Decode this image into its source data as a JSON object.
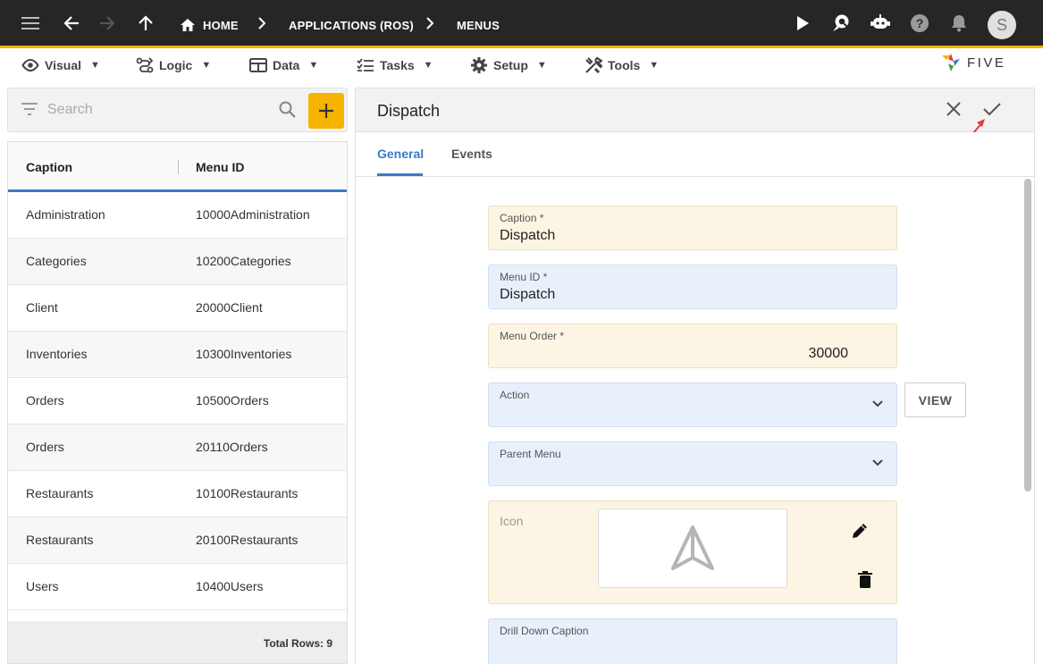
{
  "topbar": {
    "breadcrumbs": [
      "HOME",
      "APPLICATIONS (ROS)",
      "MENUS"
    ],
    "avatar_initial": "S"
  },
  "menubar": {
    "items": [
      {
        "label": "Visual",
        "icon": "eye-icon"
      },
      {
        "label": "Logic",
        "icon": "logic-icon"
      },
      {
        "label": "Data",
        "icon": "table-icon"
      },
      {
        "label": "Tasks",
        "icon": "tasks-icon"
      },
      {
        "label": "Setup",
        "icon": "gear-icon"
      },
      {
        "label": "Tools",
        "icon": "tools-icon"
      }
    ],
    "arrow": "▼",
    "logo_text": "FIVE"
  },
  "list": {
    "search_placeholder": "Search",
    "columns": [
      "Caption",
      "Menu ID"
    ],
    "rows": [
      [
        "Administration",
        "10000Administration"
      ],
      [
        "Categories",
        "10200Categories"
      ],
      [
        "Client",
        "20000Client"
      ],
      [
        "Inventories",
        "10300Inventories"
      ],
      [
        "Orders",
        "10500Orders"
      ],
      [
        "Orders",
        "20110Orders"
      ],
      [
        "Restaurants",
        "10100Restaurants"
      ],
      [
        "Restaurants",
        "20100Restaurants"
      ],
      [
        "Users",
        "10400Users"
      ]
    ],
    "total_rows": "Total Rows: 9"
  },
  "form": {
    "title": "Dispatch",
    "tabs": [
      "General",
      "Events"
    ],
    "caption_label": "Caption *",
    "caption_value": "Dispatch",
    "menuid_label": "Menu ID *",
    "menuid_value": "Dispatch",
    "order_label": "Menu Order *",
    "order_value": "30000",
    "action_label": "Action",
    "view_label": "VIEW",
    "parent_label": "Parent Menu",
    "icon_label": "Icon",
    "drill_label": "Drill Down Caption"
  },
  "colors": {
    "accent": "#f5b400",
    "tab_active": "#3a7ac8",
    "field_yellow": "#fdf5e4",
    "field_blue": "#e8f1fb",
    "annotation_arrow": "#e53935"
  }
}
